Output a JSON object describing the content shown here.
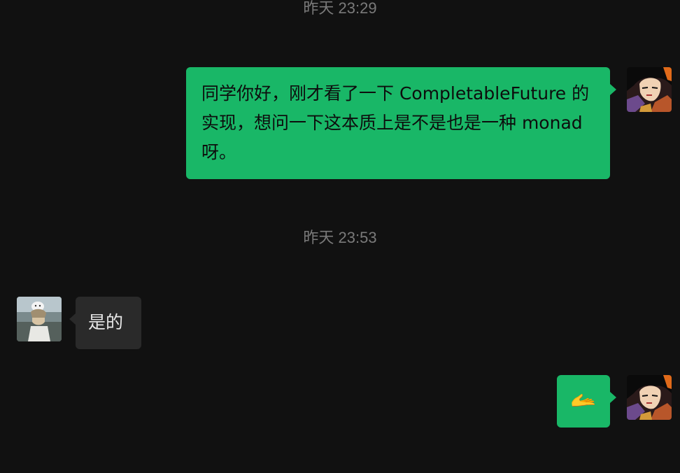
{
  "conversation": {
    "timestamps": [
      "昨天 23:29",
      "昨天 23:53"
    ],
    "messages": [
      {
        "sender": "self",
        "text": "同学你好，刚才看了一下 CompletableFuture 的实现，想问一下这本质上是不是也是一种 monad  呀。"
      },
      {
        "sender": "other",
        "text": "是的"
      },
      {
        "sender": "self",
        "text": "🫴"
      }
    ]
  },
  "colors": {
    "background": "#111111",
    "outgoing_bubble": "#19b767",
    "incoming_bubble": "#2a2a2a",
    "timestamp_text": "#7a7a7a"
  },
  "icons": {
    "self_avatar": "anime-character-avatar",
    "other_avatar": "anime-character-with-cat-avatar"
  }
}
